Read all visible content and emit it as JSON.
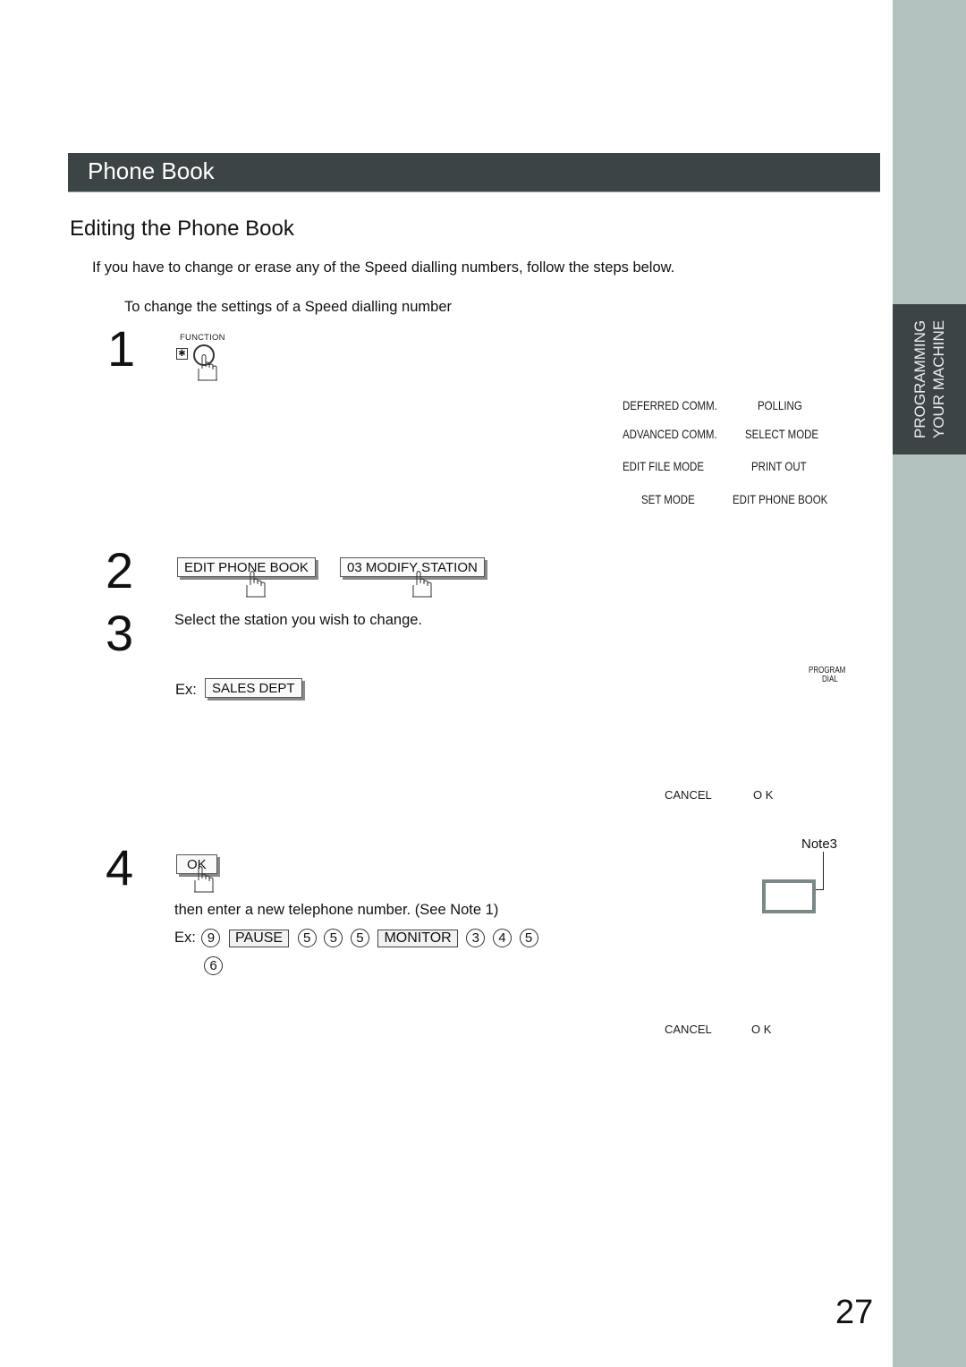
{
  "side_tab": {
    "line1": "PROGRAMMING",
    "line2": "YOUR MACHINE"
  },
  "header": {
    "title": "Phone Book"
  },
  "section": {
    "title": "Editing the Phone Book"
  },
  "intro": "If you have to change or erase any of the Speed dialling numbers, follow the steps below.",
  "subintro": "To change the settings of a Speed dialling number",
  "steps": [
    {
      "number": "1",
      "key_label": "FUNCTION",
      "star_glyph": "✱"
    },
    {
      "number": "2",
      "keys": [
        "EDIT PHONE BOOK",
        "03 MODIFY STATION"
      ]
    },
    {
      "number": "3",
      "text": "Select the station you wish to change.",
      "ex_label": "Ex:",
      "ex_key": "SALES DEPT"
    },
    {
      "number": "4",
      "key": "OK",
      "text": "then enter a new telephone number.  (See Note 1)",
      "ex_label": "Ex:",
      "sequence": [
        "9",
        "PAUSE",
        "5",
        "5",
        "5",
        "MONITOR",
        "3",
        "4",
        "5",
        "6"
      ]
    }
  ],
  "menu_display": [
    [
      "DEFERRED COMM.",
      "POLLING"
    ],
    [
      "ADVANCED COMM.",
      "SELECT MODE"
    ],
    [
      "EDIT FILE MODE",
      "PRINT OUT"
    ],
    [
      "SET MODE",
      "EDIT PHONE BOOK"
    ]
  ],
  "program_dial": {
    "line1": "PROGRAM",
    "line2": "DIAL"
  },
  "softkeys_1": {
    "cancel": "CANCEL",
    "ok": "O K"
  },
  "softkeys_2": {
    "cancel": "CANCEL",
    "ok": "O K"
  },
  "note3": "Note3",
  "page_number": "27",
  "colors": {
    "header_bg": "#3c4446",
    "side_strip": "#b3c1bf",
    "lcd_border": "#7b8888"
  }
}
